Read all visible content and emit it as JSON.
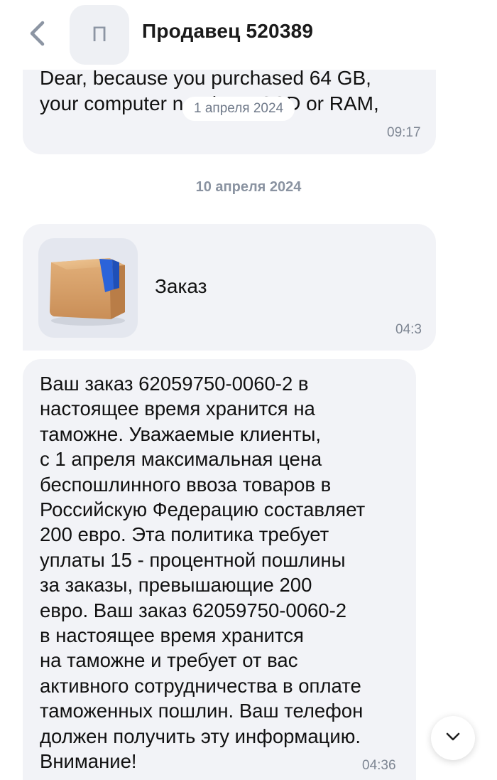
{
  "header": {
    "back_icon": "chevron-left-icon",
    "avatar_letter": "П",
    "seller_name": "Продавец 520389"
  },
  "messages": {
    "previous": {
      "partial_line": "Dear, because you purchased 64 GB,",
      "text": "your computer needs an SSD or RAM,",
      "date_badge": "1 апреля 2024",
      "time": "09:17"
    },
    "date_separator": "10 апреля 2024",
    "order_card": {
      "title": "Заказ",
      "time": "04:3",
      "image_icon": "package-box-icon"
    },
    "customs_notice": {
      "lines": [
        "Ваш заказ 62059750-0060-2 в",
        "настоящее время хранится на",
        "таможне. Уважаемые клиенты,",
        "с 1 апреля максимальная цена",
        "беспошлинного ввоза товаров в",
        "Российскую Федерацию составляет",
        "200 евро. Эта политика требует",
        "уплаты 15 - процентной пошлины",
        "за заказы, превышающие 200",
        "евро. Ваш заказ 62059750-0060-2",
        "в настоящее время хранится",
        "на таможне и требует от вас",
        "активного сотрудничества в оплате",
        "таможенных пошлин. Ваш телефон",
        "должен получить эту информацию.",
        "Внимание!"
      ],
      "time": "04:36"
    }
  },
  "scroll_button": {
    "icon": "chevron-down-icon"
  },
  "colors": {
    "bubble_bg": "#f2f3f7",
    "accent_blue": "#2b63d9",
    "box_tan": "#d9a46a"
  }
}
